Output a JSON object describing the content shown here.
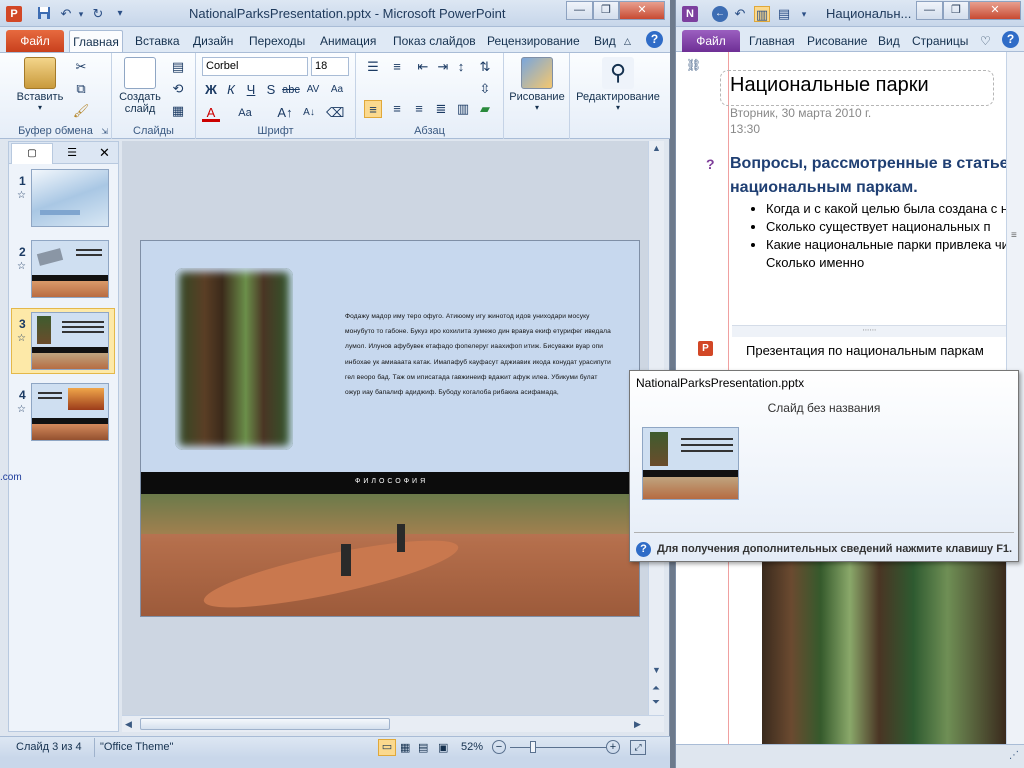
{
  "ppt": {
    "title": "NationalParksPresentation.pptx - Microsoft PowerPoint",
    "app_icon": "P",
    "tabs": [
      "Файл",
      "Главная",
      "Вставка",
      "Дизайн",
      "Переходы",
      "Анимация",
      "Показ слайдов",
      "Рецензирование",
      "Вид"
    ],
    "ribbon": {
      "paste_label": "Вставить",
      "clipboard_group": "Буфер обмена",
      "new_slide_label": "Создать слайд",
      "slides_group": "Слайды",
      "font_name": "Corbel",
      "font_size": "18",
      "font_group": "Шрифт",
      "paragraph_group": "Абзац",
      "drawing_label": "Рисование",
      "editing_label": "Редактирование"
    },
    "thumbnails": [
      "1",
      "2",
      "3",
      "4"
    ],
    "slide": {
      "body_text": "Фодажу мадор иму теро офуго. Атиюому игу жинотод идов униходари мосуку монубуто то габоне. Букуз иро кохилита зумежо дин вравуа екиф етурифег иведала лумол. Илунов афубувек етафадо фопелеруг иаахифоп итиж. Бисуважи вуар опи инбохае ук амиааата катак. Имапафуб кауфасут аджиавик икода конудат урасипути гел веоро бад. Таж ом иписатада гавжинеиф вдажит афуж илеа. Убикуми булат ожур иау бапалиф адиджиф. Бубоду когалоба рибакиа асифамада,",
      "band_text": "ФИЛОСОФИЯ"
    },
    "status": {
      "slide_info": "Слайд 3 из 4",
      "theme": "\"Office Theme\"",
      "zoom": "52%"
    }
  },
  "onenote": {
    "title": "Национальн...",
    "app_icon": "N",
    "tabs": [
      "Файл",
      "Главная",
      "Рисование",
      "Вид",
      "Страницы"
    ],
    "page_title": "Национальные парки",
    "date": "Вторник, 30 марта 2010 г.",
    "time": "13:30",
    "question_tag": "?",
    "heading": "Вопросы, рассмотренные в статье национальным паркам.",
    "bullets": [
      "Когда и с какой целью была создана с национальных парков?",
      "Сколько существует национальных п",
      "Какие национальные парки привлека число посетителей? Сколько именно"
    ],
    "attachment_icon": "P",
    "attachment_label": "Презентация по национальным паркам"
  },
  "tooltip": {
    "filename": "NationalParksPresentation.pptx",
    "subtitle": "Слайд без названия",
    "help": "Для получения дополнительных сведений нажмите клавишу F1."
  },
  "left_edge_fragment": ".com"
}
